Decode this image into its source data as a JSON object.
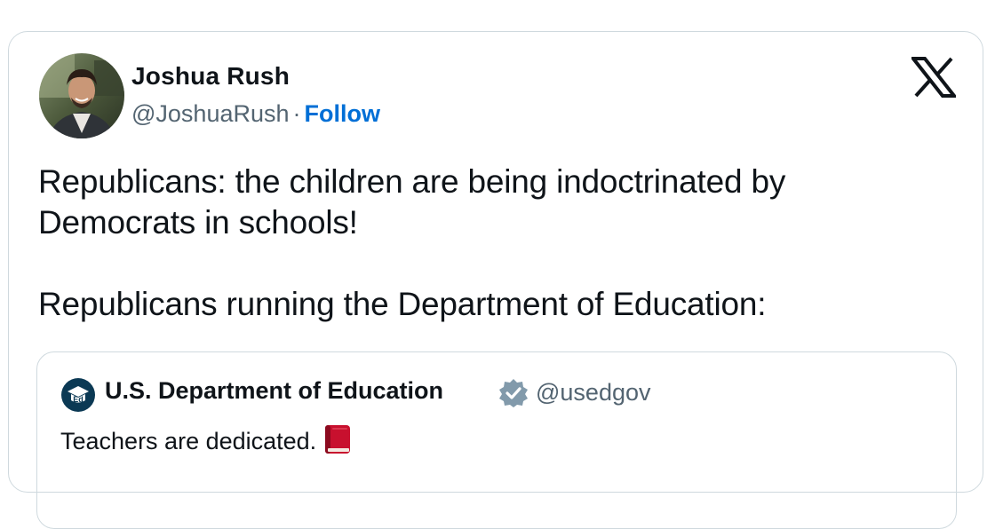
{
  "author": {
    "name": "Joshua Rush",
    "handle": "@JoshuaRush",
    "separator": "·",
    "follow_label": "Follow"
  },
  "tweet": {
    "text": "Republicans: the children are being indoctrinated by\nDemocrats in schools!\n\nRepublicans running the Department of Education:"
  },
  "quoted": {
    "name": "U.S. Department of Education",
    "handle": "@usedgov",
    "text": "Teachers are dedicated.",
    "emoji_icon": "red-book-icon"
  },
  "colors": {
    "accent": "#006fd6",
    "secondary_text": "#536471",
    "border": "#cfd9de",
    "verified": "#829aab"
  },
  "icons": [
    "avatar",
    "x-logo-icon",
    "ed-seal-icon",
    "verified-badge-icon",
    "red-book-icon"
  ]
}
